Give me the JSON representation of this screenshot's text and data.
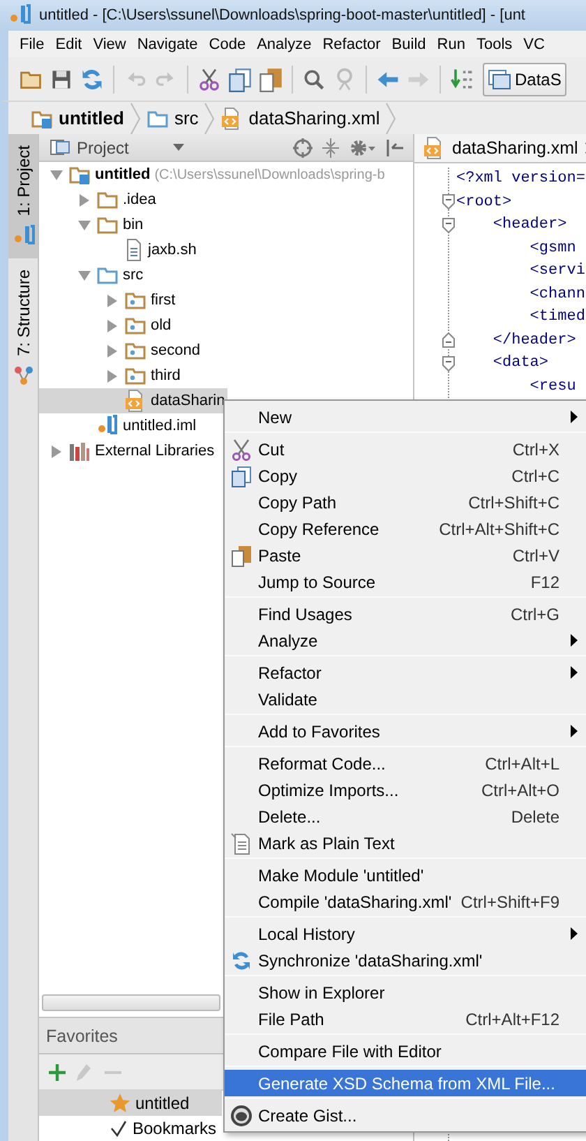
{
  "window": {
    "title": "untitled - [C:\\Users\\ssunel\\Downloads\\spring-boot-master\\untitled] - [unt"
  },
  "menu_bar": [
    "File",
    "Edit",
    "View",
    "Navigate",
    "Code",
    "Analyze",
    "Refactor",
    "Build",
    "Run",
    "Tools",
    "VC"
  ],
  "toolbar": [
    {
      "kind": "open",
      "disabled": false
    },
    {
      "kind": "save",
      "disabled": false
    },
    {
      "kind": "sync",
      "disabled": false
    },
    {
      "kind": "separator"
    },
    {
      "kind": "undo",
      "disabled": true
    },
    {
      "kind": "redo",
      "disabled": true
    },
    {
      "kind": "separator"
    },
    {
      "kind": "cut",
      "disabled": false
    },
    {
      "kind": "copy",
      "disabled": false
    },
    {
      "kind": "paste",
      "disabled": false
    },
    {
      "kind": "separator"
    },
    {
      "kind": "find",
      "disabled": false
    },
    {
      "kind": "replace",
      "disabled": true
    },
    {
      "kind": "separator"
    },
    {
      "kind": "back",
      "disabled": false
    },
    {
      "kind": "forward",
      "disabled": true
    },
    {
      "kind": "separator"
    },
    {
      "kind": "binary",
      "disabled": false
    },
    {
      "kind": "run-config",
      "label": "DataS"
    }
  ],
  "breadcrumbs": [
    {
      "label": "untitled",
      "kind": "module"
    },
    {
      "label": "src",
      "kind": "source-folder"
    },
    {
      "label": "dataSharing.xml",
      "kind": "xml-file"
    }
  ],
  "side_tabs": [
    {
      "label": "1: Project",
      "kind": "project",
      "selected": true
    },
    {
      "label": "7: Structure",
      "kind": "structure",
      "selected": false
    }
  ],
  "project_panel": {
    "title": "Project",
    "tree": [
      {
        "label": "untitled",
        "path": "(C:\\Users\\ssunel\\Downloads\\spring-b",
        "kind": "module",
        "expanded": true,
        "selected": false,
        "children": [
          {
            "label": ".idea",
            "kind": "folder",
            "expanded": false,
            "selected": false
          },
          {
            "label": "bin",
            "kind": "folder",
            "expanded": true,
            "selected": false,
            "children": [
              {
                "label": "jaxb.sh",
                "kind": "text-file",
                "selected": false
              }
            ]
          },
          {
            "label": "src",
            "kind": "source-folder",
            "expanded": true,
            "selected": false,
            "children": [
              {
                "label": "first",
                "kind": "package",
                "expanded": false,
                "selected": false
              },
              {
                "label": "old",
                "kind": "package",
                "expanded": false,
                "selected": false
              },
              {
                "label": "second",
                "kind": "package",
                "expanded": false,
                "selected": false
              },
              {
                "label": "third",
                "kind": "package",
                "expanded": false,
                "selected": false
              },
              {
                "label": "dataSharin",
                "kind": "xml-file",
                "selected": true
              }
            ]
          },
          {
            "label": "untitled.iml",
            "kind": "module-file",
            "selected": false
          }
        ]
      },
      {
        "label": "External Libraries",
        "kind": "libraries",
        "expanded": false,
        "selected": false
      }
    ]
  },
  "favorites": {
    "title": "Favorites",
    "tools": [
      {
        "kind": "add",
        "disabled": false
      },
      {
        "kind": "edit",
        "disabled": true
      },
      {
        "kind": "remove",
        "disabled": true
      }
    ],
    "items": [
      {
        "label": "untitled",
        "kind": "star",
        "selected": true
      },
      {
        "label": "Bookmarks",
        "kind": "check",
        "selected": false
      }
    ]
  },
  "editor": {
    "tab": "dataSharing.xml",
    "lines": [
      {
        "text": "<?xml version=",
        "kind": "plain"
      },
      {
        "text": "<root>",
        "kind": "fold-start"
      },
      {
        "text": "    <header>",
        "kind": "fold-start"
      },
      {
        "text": "        <gsmn",
        "kind": "plain"
      },
      {
        "text": "        <servi",
        "kind": "plain"
      },
      {
        "text": "        <chann",
        "kind": "plain"
      },
      {
        "text": "        <timed",
        "kind": "plain"
      },
      {
        "text": "    </header>",
        "kind": "fold-end"
      },
      {
        "text": "    <data>",
        "kind": "fold-start"
      },
      {
        "text": "        <resu",
        "kind": "plain"
      }
    ]
  },
  "context_menu": [
    {
      "kind": "item",
      "label": "New",
      "submenu": true,
      "selected": false
    },
    {
      "kind": "separator"
    },
    {
      "kind": "cut",
      "label": "Cut",
      "shortcut": "Ctrl+X",
      "selected": false
    },
    {
      "kind": "copy",
      "label": "Copy",
      "shortcut": "Ctrl+C",
      "selected": false
    },
    {
      "kind": "item",
      "label": "Copy Path",
      "shortcut": "Ctrl+Shift+C",
      "selected": false
    },
    {
      "kind": "item",
      "label": "Copy Reference",
      "shortcut": "Ctrl+Alt+Shift+C",
      "selected": false
    },
    {
      "kind": "paste",
      "label": "Paste",
      "shortcut": "Ctrl+V",
      "selected": false
    },
    {
      "kind": "item",
      "label": "Jump to Source",
      "shortcut": "F12",
      "selected": false
    },
    {
      "kind": "separator"
    },
    {
      "kind": "item",
      "label": "Find Usages",
      "shortcut": "Ctrl+G",
      "selected": false
    },
    {
      "kind": "item",
      "label": "Analyze",
      "submenu": true,
      "selected": false
    },
    {
      "kind": "separator"
    },
    {
      "kind": "item",
      "label": "Refactor",
      "submenu": true,
      "selected": false
    },
    {
      "kind": "item",
      "label": "Validate",
      "selected": false
    },
    {
      "kind": "separator"
    },
    {
      "kind": "item",
      "label": "Add to Favorites",
      "submenu": true,
      "selected": false
    },
    {
      "kind": "separator"
    },
    {
      "kind": "item",
      "label": "Reformat Code...",
      "shortcut": "Ctrl+Alt+L",
      "selected": false
    },
    {
      "kind": "item",
      "label": "Optimize Imports...",
      "shortcut": "Ctrl+Alt+O",
      "selected": false
    },
    {
      "kind": "item",
      "label": "Delete...",
      "shortcut": "Delete",
      "selected": false
    },
    {
      "kind": "document",
      "label": "Mark as Plain Text",
      "selected": false
    },
    {
      "kind": "separator"
    },
    {
      "kind": "item",
      "label": "Make Module 'untitled'",
      "selected": false
    },
    {
      "kind": "item",
      "label": "Compile 'dataSharing.xml'",
      "shortcut": "Ctrl+Shift+F9",
      "selected": false
    },
    {
      "kind": "separator"
    },
    {
      "kind": "item",
      "label": "Local History",
      "submenu": true,
      "selected": false
    },
    {
      "kind": "sync",
      "label": "Synchronize 'dataSharing.xml'",
      "selected": false
    },
    {
      "kind": "separator"
    },
    {
      "kind": "item",
      "label": "Show in Explorer",
      "selected": false
    },
    {
      "kind": "item",
      "label": "File Path",
      "shortcut": "Ctrl+Alt+F12",
      "selected": false
    },
    {
      "kind": "separator"
    },
    {
      "kind": "item",
      "label": "Compare File with Editor",
      "selected": false
    },
    {
      "kind": "separator"
    },
    {
      "kind": "item",
      "label": "Generate XSD Schema from XML File...",
      "selected": true
    },
    {
      "kind": "separator"
    },
    {
      "kind": "gist",
      "label": "Create Gist...",
      "selected": false
    }
  ]
}
